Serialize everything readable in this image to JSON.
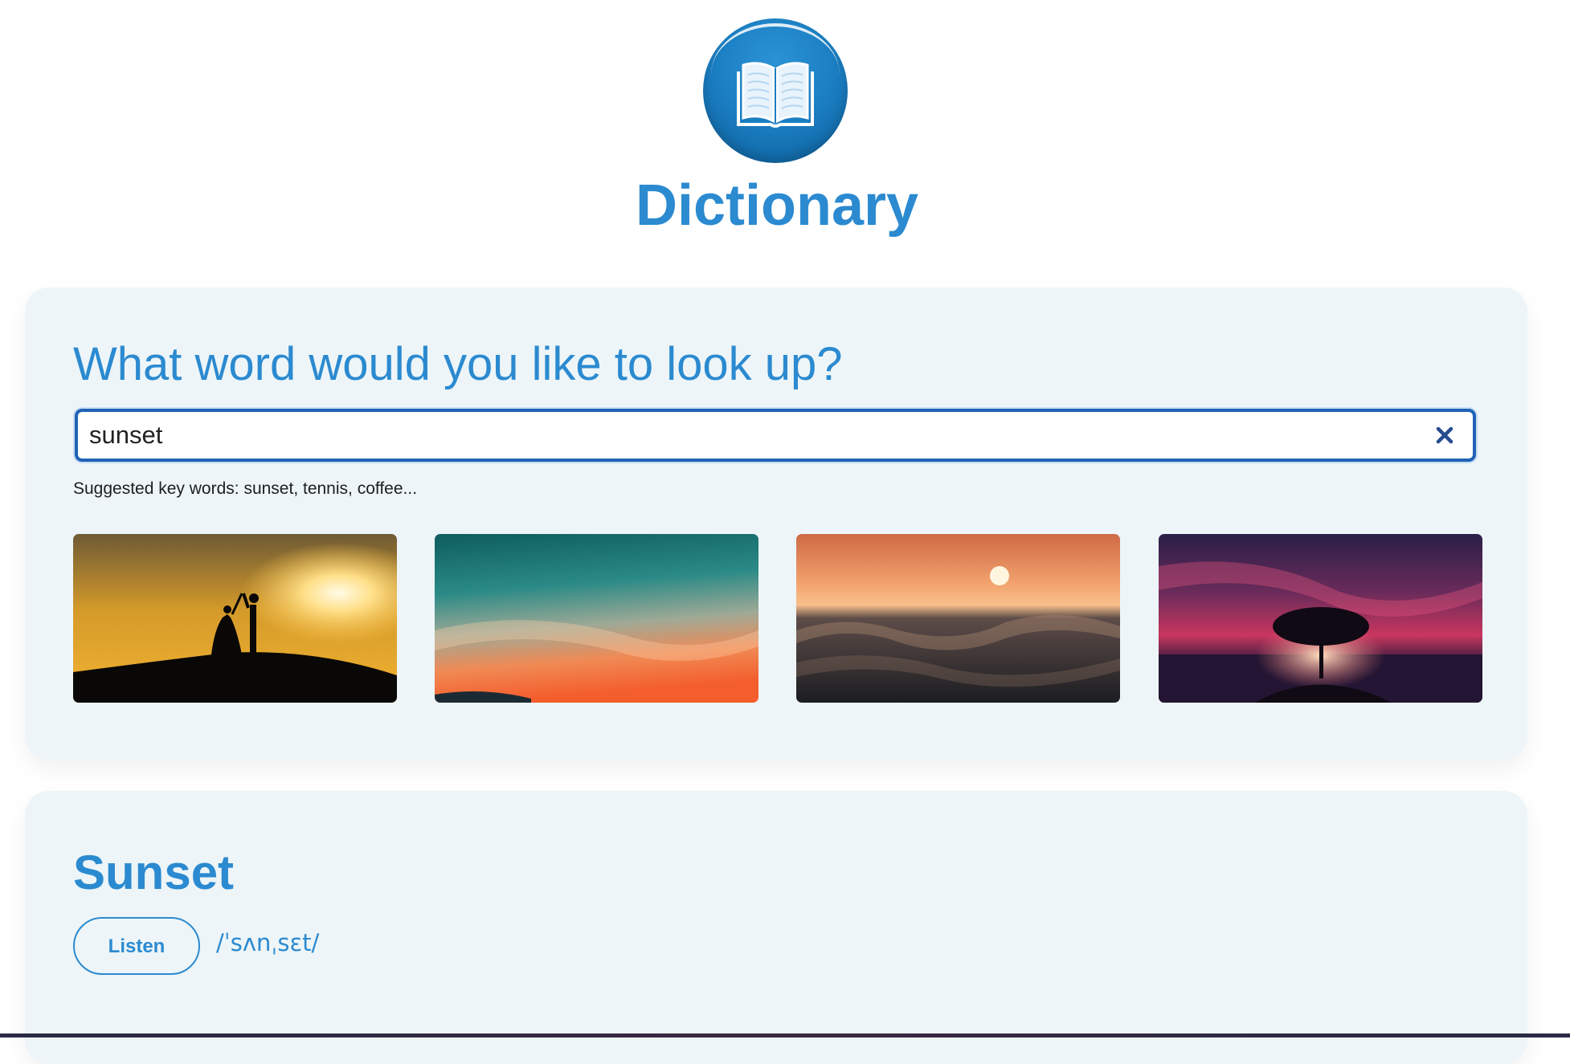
{
  "app": {
    "title": "Dictionary",
    "logo_icon": "open-book-icon",
    "accent_color": "#2b8ad0"
  },
  "search": {
    "heading": "What word would you like to look up?",
    "value": "sunset",
    "clear_icon": "close-icon",
    "suggestion": "Suggested key words: sunset, tennis, coffee..."
  },
  "images": [
    {
      "subject": "couple silhouette at sunset"
    },
    {
      "subject": "teal and orange sunset sky"
    },
    {
      "subject": "sun over ocean waves"
    },
    {
      "subject": "lone tree under red sky"
    }
  ],
  "result": {
    "word": "Sunset",
    "listen_label": "Listen",
    "phonetic": "/ˈsʌnˌsɛt/"
  }
}
